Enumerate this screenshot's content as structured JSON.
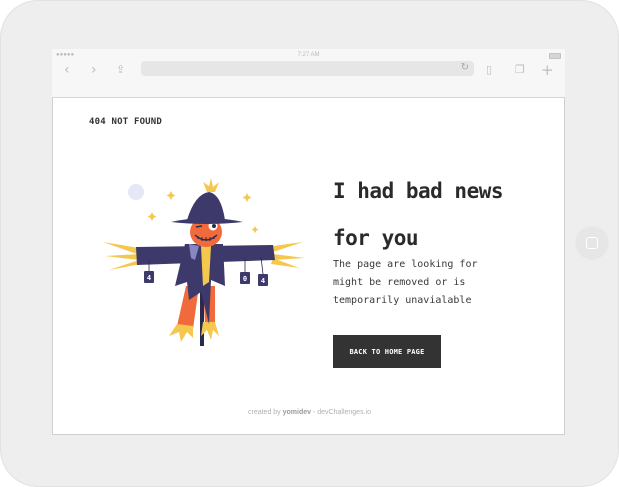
{
  "device": {
    "status_time": "7:27 AM"
  },
  "page": {
    "brand": "404 NOT FOUND",
    "headline_line1": "I had bad news",
    "headline_line2": "for you",
    "message": "The page are looking for might be removed or is temporarily unavialable",
    "cta_label": "BACK TO HOME PAGE",
    "footer_prefix": "created by ",
    "footer_author": "yomidev",
    "footer_suffix": " - devChallenges.io"
  },
  "illustration": {
    "sign_left": "4",
    "sign_mid": "0",
    "sign_right": "4"
  },
  "colors": {
    "button_bg": "#333333",
    "scarecrow_hat": "#3d3a6b",
    "scarecrow_face": "#f16a3b",
    "straw": "#f4c84f"
  }
}
